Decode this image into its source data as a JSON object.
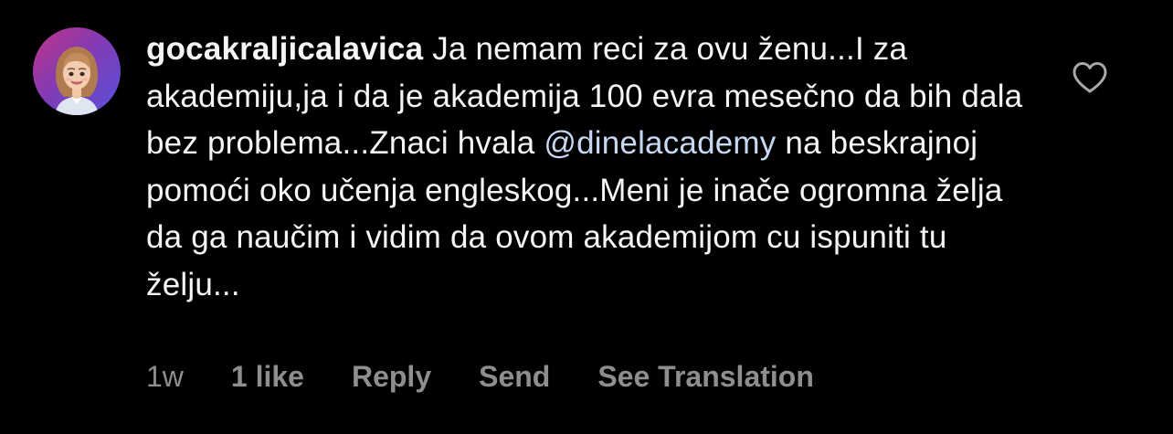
{
  "comment": {
    "username": "gocakraljicalavica",
    "text_before_mention": "Ja nemam reci za ovu ženu...I za akademiju,ja i da je akademija 100 evra mesečno da bih dala bez problema...Znaci hvala",
    "mention": "@dinelacademy",
    "text_after_mention": "na beskrajnoj pomoći oko učenja engleskog...Meni je inače ogromna želja da ga naučim i vidim da ovom akademijom cu ispuniti tu želju...",
    "timestamp": "1w",
    "likes_label": "1 like",
    "reply_label": "Reply",
    "send_label": "Send",
    "translate_label": "See Translation"
  },
  "icons": {
    "like": "heart-outline-icon",
    "avatar": "avatar-memoji"
  },
  "colors": {
    "background": "#000000",
    "text": "#f5f5f5",
    "secondary_text": "#8e8e8e",
    "mention": "#c7d8f2",
    "avatar_ring_start": "#c13584",
    "avatar_ring_end": "#5851db"
  }
}
